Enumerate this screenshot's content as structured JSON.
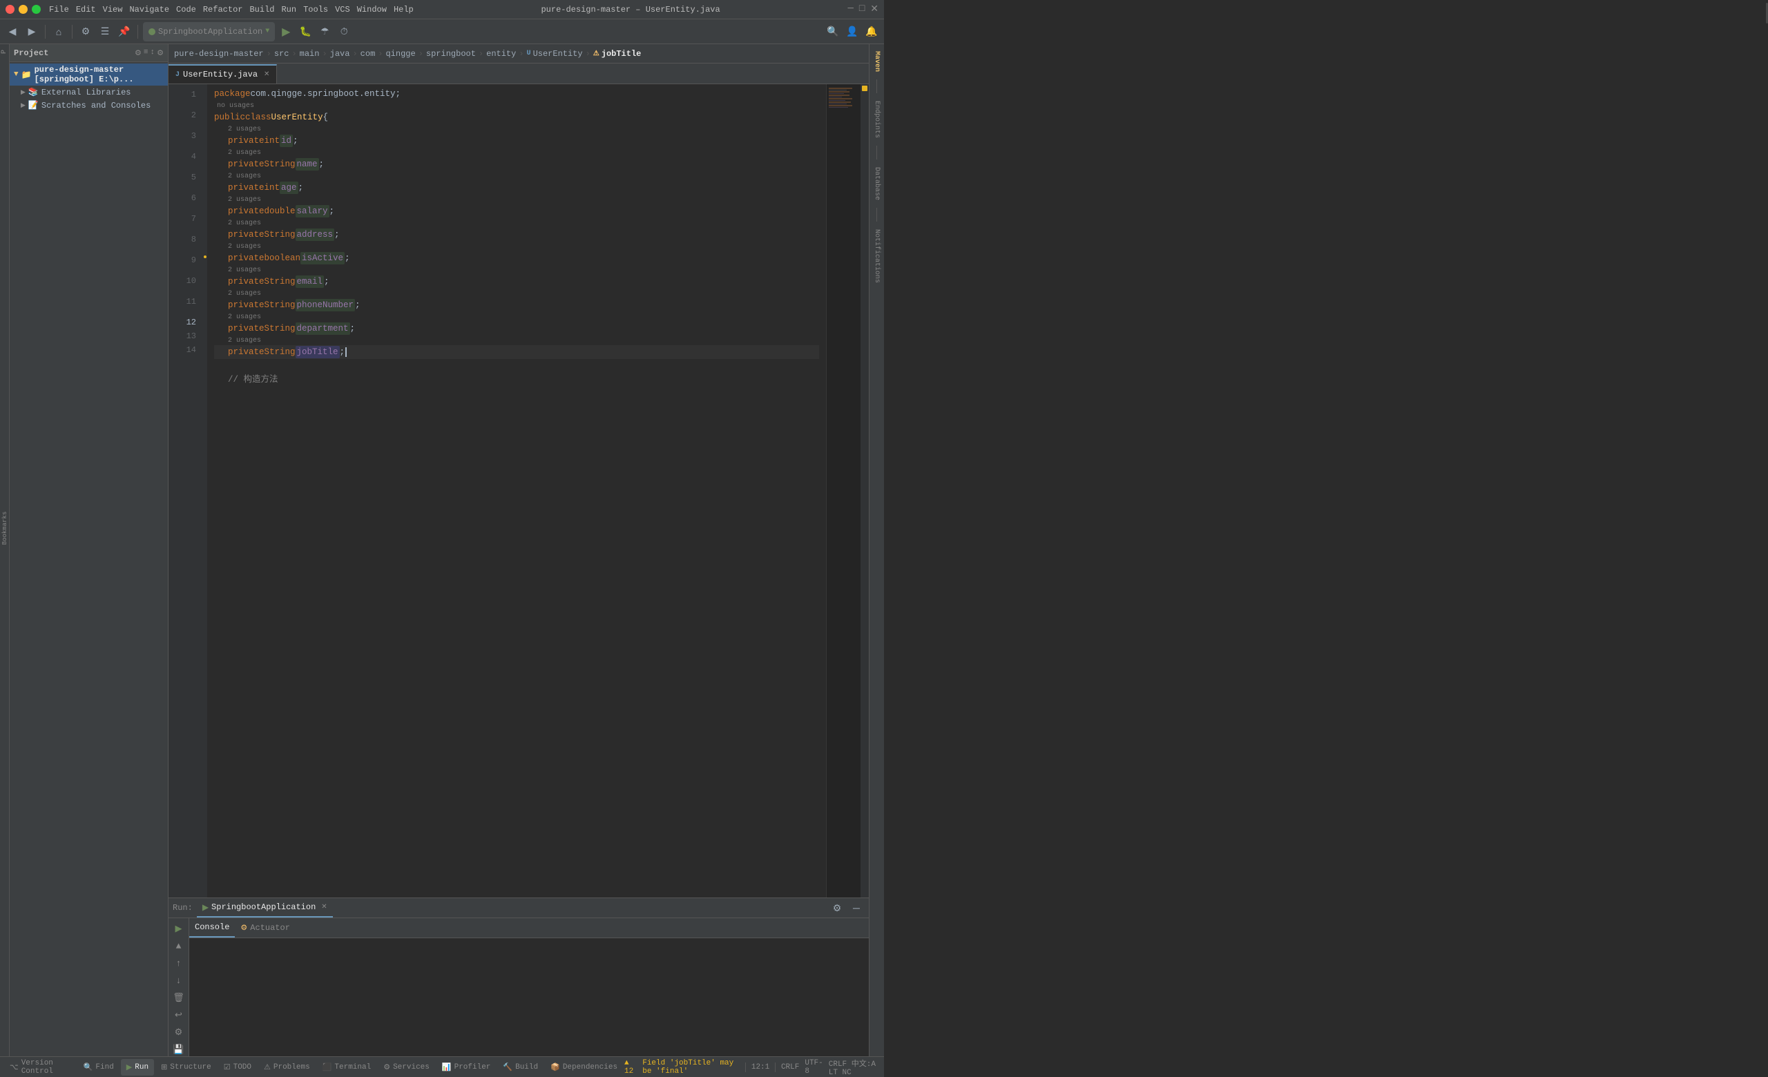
{
  "window": {
    "title": "pure-design-master – UserEntity.java",
    "os_buttons": [
      "close",
      "minimize",
      "maximize"
    ]
  },
  "menu": {
    "items": [
      "File",
      "Edit",
      "View",
      "Navigate",
      "Code",
      "Refactor",
      "Build",
      "Run",
      "Tools",
      "VCS",
      "Window",
      "Help"
    ]
  },
  "toolbar": {
    "project_label": "Project",
    "run_config": "SpringbootApplication",
    "run_label": "Run",
    "debug_label": "Debug"
  },
  "breadcrumb": {
    "items": [
      "pure-design-master",
      "src",
      "main",
      "java",
      "com",
      "qingge",
      "springboot",
      "entity",
      "UserEntity",
      "jobTitle"
    ]
  },
  "project_panel": {
    "title": "Project",
    "items": [
      {
        "label": "pure-design-master [springboot] E:\\p...",
        "indent": 0,
        "type": "project",
        "expanded": true
      },
      {
        "label": "External Libraries",
        "indent": 1,
        "type": "folder",
        "expanded": false
      },
      {
        "label": "Scratches and Consoles",
        "indent": 1,
        "type": "scratches",
        "expanded": false
      }
    ]
  },
  "tabs": [
    {
      "label": "UserEntity.java",
      "active": true,
      "modified": false
    }
  ],
  "code": {
    "filename": "UserEntity.java",
    "lines": [
      {
        "num": 1,
        "tokens": [
          {
            "type": "kw-package",
            "text": "package"
          },
          {
            "type": "pkg",
            "text": " com.qingge.springboot.entity;"
          },
          {
            "type": "no-usages",
            "text": "no usages"
          }
        ]
      },
      {
        "num": 2,
        "tokens": [
          {
            "type": "kw-public",
            "text": "public"
          },
          {
            "type": "punc",
            "text": " "
          },
          {
            "type": "kw-class",
            "text": "class"
          },
          {
            "type": "punc",
            "text": " "
          },
          {
            "type": "class-name",
            "text": "UserEntity"
          },
          {
            "type": "punc",
            "text": " {"
          }
        ],
        "usage": "2 usages"
      },
      {
        "num": 3,
        "tokens": [
          {
            "type": "kw-private",
            "text": "private"
          },
          {
            "type": "punc",
            "text": " "
          },
          {
            "type": "kw-int",
            "text": "int"
          },
          {
            "type": "punc",
            "text": " "
          },
          {
            "type": "field",
            "text": "id"
          },
          {
            "type": "punc",
            "text": ";"
          }
        ],
        "usage": "2 usages"
      },
      {
        "num": 4,
        "tokens": [
          {
            "type": "kw-private",
            "text": "private"
          },
          {
            "type": "punc",
            "text": " "
          },
          {
            "type": "kw-string",
            "text": "String"
          },
          {
            "type": "punc",
            "text": " "
          },
          {
            "type": "field",
            "text": "name"
          },
          {
            "type": "punc",
            "text": ";"
          }
        ],
        "usage": "2 usages"
      },
      {
        "num": 5,
        "tokens": [
          {
            "type": "kw-private",
            "text": "private"
          },
          {
            "type": "punc",
            "text": " "
          },
          {
            "type": "kw-int",
            "text": "int"
          },
          {
            "type": "punc",
            "text": " "
          },
          {
            "type": "field",
            "text": "age"
          },
          {
            "type": "punc",
            "text": ";"
          }
        ],
        "usage": "2 usages"
      },
      {
        "num": 6,
        "tokens": [
          {
            "type": "kw-private",
            "text": "private"
          },
          {
            "type": "punc",
            "text": " "
          },
          {
            "type": "kw-double",
            "text": "double"
          },
          {
            "type": "punc",
            "text": " "
          },
          {
            "type": "field",
            "text": "salary"
          },
          {
            "type": "punc",
            "text": ";"
          }
        ],
        "usage": "2 usages"
      },
      {
        "num": 7,
        "tokens": [
          {
            "type": "kw-private",
            "text": "private"
          },
          {
            "type": "punc",
            "text": " "
          },
          {
            "type": "kw-string",
            "text": "String"
          },
          {
            "type": "punc",
            "text": " "
          },
          {
            "type": "field",
            "text": "address"
          },
          {
            "type": "punc",
            "text": ";"
          }
        ],
        "usage": "2 usages"
      },
      {
        "num": 8,
        "tokens": [
          {
            "type": "kw-private",
            "text": "private"
          },
          {
            "type": "punc",
            "text": " "
          },
          {
            "type": "kw-boolean",
            "text": "boolean"
          },
          {
            "type": "punc",
            "text": " "
          },
          {
            "type": "field",
            "text": "isActive"
          },
          {
            "type": "punc",
            "text": ";"
          }
        ],
        "usage": "2 usages"
      },
      {
        "num": 9,
        "tokens": [
          {
            "type": "kw-private",
            "text": "private"
          },
          {
            "type": "punc",
            "text": " "
          },
          {
            "type": "kw-string",
            "text": "String"
          },
          {
            "type": "punc",
            "text": " "
          },
          {
            "type": "field",
            "text": "email"
          },
          {
            "type": "punc",
            "text": ";"
          }
        ],
        "usage": "2 usages"
      },
      {
        "num": 10,
        "tokens": [
          {
            "type": "kw-private",
            "text": "private"
          },
          {
            "type": "punc",
            "text": " "
          },
          {
            "type": "kw-string",
            "text": "String"
          },
          {
            "type": "punc",
            "text": " "
          },
          {
            "type": "field",
            "text": "phoneNumber"
          },
          {
            "type": "punc",
            "text": ";"
          }
        ],
        "usage": "2 usages"
      },
      {
        "num": 11,
        "tokens": [
          {
            "type": "kw-private",
            "text": "private"
          },
          {
            "type": "punc",
            "text": " "
          },
          {
            "type": "kw-string",
            "text": "String"
          },
          {
            "type": "punc",
            "text": " "
          },
          {
            "type": "field",
            "text": "department"
          },
          {
            "type": "punc",
            "text": ";"
          }
        ],
        "usage": "2 usages"
      },
      {
        "num": 12,
        "tokens": [
          {
            "type": "kw-private",
            "text": "private"
          },
          {
            "type": "punc",
            "text": " "
          },
          {
            "type": "kw-string",
            "text": "String"
          },
          {
            "type": "punc",
            "text": " "
          },
          {
            "type": "field-hl",
            "text": "jobTitle"
          },
          {
            "type": "punc",
            "text": ";"
          }
        ]
      },
      {
        "num": 13,
        "tokens": []
      },
      {
        "num": 14,
        "tokens": [
          {
            "type": "comment",
            "text": "    // 构造方法"
          }
        ]
      }
    ]
  },
  "run_panel": {
    "run_label": "Run:",
    "config_name": "SpringbootApplication",
    "tabs": [
      {
        "label": "Console",
        "active": true
      },
      {
        "label": "Actuator",
        "active": false
      }
    ]
  },
  "status_bar": {
    "version_control": "Version Control",
    "find": "Find",
    "run": "Run",
    "structure": "Structure",
    "todo": "TODO",
    "problems": "Problems",
    "terminal": "Terminal",
    "services": "Services",
    "profiler": "Profiler",
    "build": "Build",
    "dependencies": "Dependencies",
    "warning_msg": "Field 'jobTitle' may be 'final'",
    "caret_pos": "12:1",
    "column": "1",
    "encoding": "UTF-8",
    "line_sep": "CRLF",
    "warnings_count": "12"
  },
  "right_panels": {
    "maven": "Maven",
    "endpoints": "Endpoints",
    "database": "Database",
    "notifications": "Notifications"
  },
  "colors": {
    "bg": "#2b2b2b",
    "sidebar_bg": "#3c3f41",
    "accent_blue": "#6897bb",
    "accent_green": "#6a8759",
    "accent_orange": "#cc7832",
    "accent_purple": "#9876aa",
    "accent_yellow": "#e8bf6a"
  }
}
